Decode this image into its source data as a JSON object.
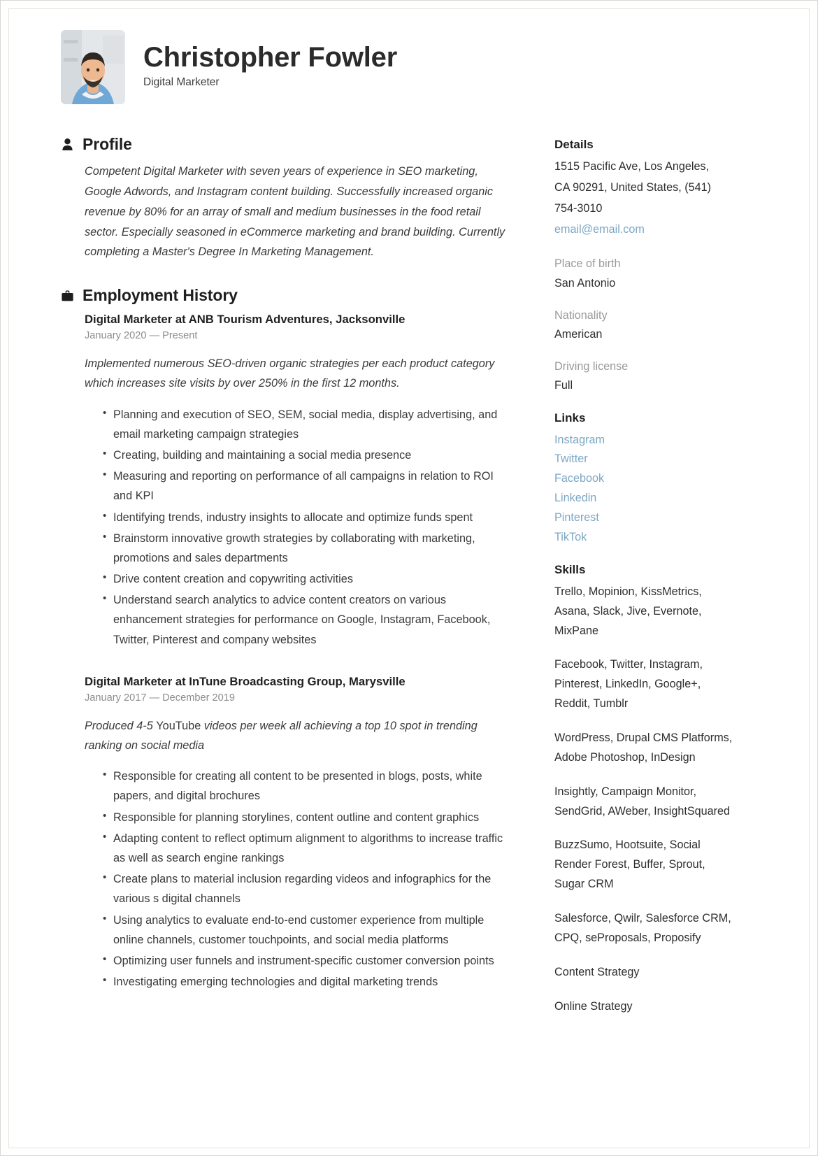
{
  "header": {
    "name": "Christopher Fowler",
    "job_title": "Digital Marketer",
    "avatar_alt": "portrait-photo"
  },
  "profile": {
    "heading": "Profile",
    "icon": "person-icon",
    "text": "Competent Digital Marketer with seven years of experience in SEO marketing, Google Adwords, and Instagram content building. Successfully increased organic revenue by 80% for an array of small and medium businesses in the food retail sector. Especially seasoned in eCommerce marketing and brand building. Currently completing a Master's Degree In Marketing Management."
  },
  "employment": {
    "heading": "Employment History",
    "icon": "briefcase-icon",
    "jobs": [
      {
        "role": "Digital Marketer at  ANB Tourism Adventures, Jacksonville",
        "dates": "January 2020 — Present",
        "description": "Implemented numerous SEO-driven organic strategies per each product category which increases site visits by over 250% in the first 12 months.",
        "bullets": [
          "Planning and execution of SEO, SEM, social media, display advertising, and email marketing campaign strategies",
          "Creating, building and maintaining a social media presence",
          "Measuring and reporting on performance of all campaigns in relation to ROI and KPI",
          "Identifying trends, industry insights to allocate and optimize funds spent",
          "Brainstorm innovative growth strategies by collaborating with marketing, promotions and sales departments",
          "Drive content creation and copywriting activities",
          "Understand search analytics to advice content creators on various enhancement strategies for performance on Google, Instagram, Facebook, Twitter, Pinterest and company websites"
        ]
      },
      {
        "role": "Digital Marketer at  InTune Broadcasting Group, Marysville",
        "dates": "January 2017 — December 2019",
        "description_pre": "Produced 4-5 ",
        "description_roman": "YouTube",
        "description_post": " videos per week all achieving a top 10 spot in trending ranking on social media",
        "bullets": [
          "Responsible for creating all content to be presented in blogs, posts, white papers, and digital brochures",
          "Responsible for planning storylines, content outline and content graphics",
          "Adapting content to reflect optimum alignment to algorithms to increase traffic as well as search engine rankings",
          "Create plans to material inclusion regarding videos and infographics for the various s digital channels",
          "Using analytics to evaluate end-to-end customer experience from multiple online channels, customer touchpoints, and social media platforms",
          "Optimizing user funnels and instrument-specific customer conversion points",
          "Investigating emerging technologies and digital marketing trends"
        ]
      }
    ]
  },
  "details": {
    "heading": "Details",
    "address_line1": "1515 Pacific Ave, Los Angeles,",
    "address_line2": "CA 90291, United States, (541)",
    "address_line3": "754-3010",
    "email": "email@email.com",
    "fields": [
      {
        "label": "Place of birth",
        "value": "San Antonio"
      },
      {
        "label": "Nationality",
        "value": "American"
      },
      {
        "label": "Driving license",
        "value": "Full"
      }
    ]
  },
  "links": {
    "heading": "Links",
    "items": [
      "Instagram",
      "Twitter",
      "Facebook",
      "Linkedin",
      "Pinterest",
      "TikTok"
    ]
  },
  "skills": {
    "heading": "Skills",
    "groups": [
      "Trello, Mopinion, KissMetrics, Asana, Slack, Jive, Evernote, MixPane",
      "Facebook, Twitter, Instagram, Pinterest, LinkedIn, Google+, Reddit, Tumblr",
      "WordPress, Drupal CMS Platforms, Adobe Photoshop, InDesign",
      "Insightly, Campaign Monitor, SendGrid, AWeber, InsightSquared",
      "BuzzSumo, Hootsuite, Social Render Forest, Buffer, Sprout, Sugar CRM",
      "Salesforce, Qwilr, Salesforce CRM, CPQ, seProposals, Proposify",
      "Content Strategy",
      "Online Strategy"
    ]
  },
  "colors": {
    "link": "#7ca7c4",
    "heading": "#1e1e1e",
    "body": "#3a3a3a",
    "muted": "#9a9a9a",
    "date": "#8d8d8d"
  }
}
